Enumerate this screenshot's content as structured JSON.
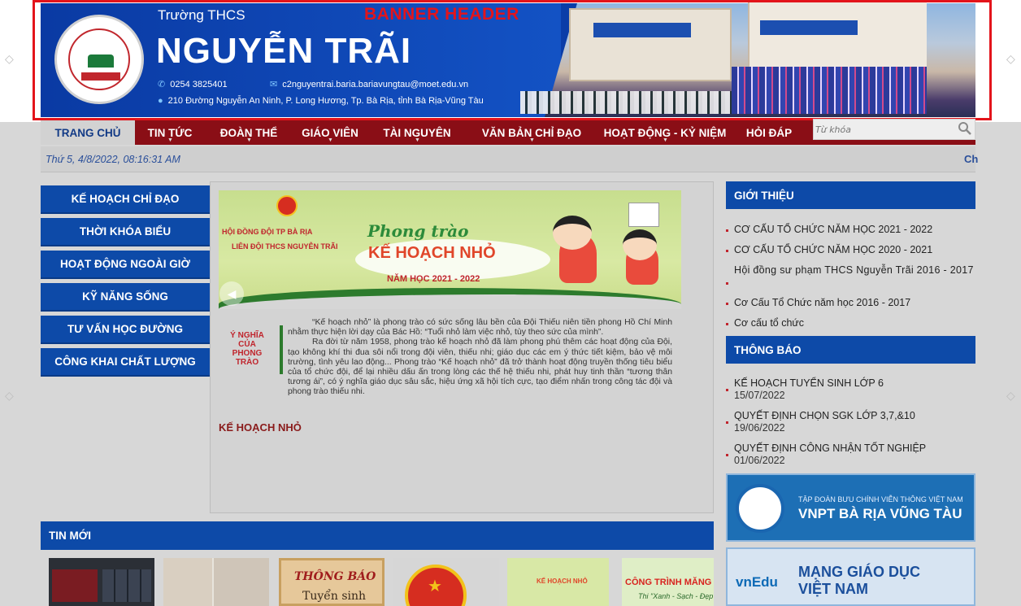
{
  "banner": {
    "tag": "BANNER HEADER",
    "school_prefix": "Trường THCS",
    "school_name": "NGUYỄN TRÃI",
    "phone": "0254 3825401",
    "email": "c2nguyentrai.baria.bariavungtau@moet.edu.vn",
    "address": "210 Đường Nguyễn An Ninh, P. Long Hương, Tp. Bà Rịa, tỉnh Bà Rịa-Vũng Tàu",
    "logo_text": "NGUYỄN TRÃI",
    "icons": [
      "phone-icon",
      "email-icon",
      "location-icon"
    ]
  },
  "nav": {
    "items": [
      {
        "label": "TRANG CHỦ",
        "active": true
      },
      {
        "label": "TIN TỨC"
      },
      {
        "label": "ĐOÀN THỂ"
      },
      {
        "label": "GIÁO VIÊN"
      },
      {
        "label": "TÀI NGUYÊN"
      },
      {
        "label": "VĂN BẢN CHỈ ĐẠO"
      },
      {
        "label": "HOẠT ĐỘNG - KỶ NIỆM"
      },
      {
        "label": "HỎI ĐÁP"
      }
    ],
    "search_placeholder": "Từ khóa"
  },
  "datebar": {
    "date": "Thứ 5, 4/8/2022, 08:16:31 AM",
    "marquee": "Ch"
  },
  "left_menu": [
    "KẾ HOẠCH CHỈ ĐẠO",
    "THỜI KHÓA BIỂU",
    "HOẠT ĐỘNG NGOÀI GIỜ",
    "KỸ NĂNG SỐNG",
    "TƯ VẤN HỌC ĐƯỜNG",
    "CÔNG KHAI CHẤT LƯỢNG"
  ],
  "poster": {
    "org_line1": "HỘI ĐỒNG ĐỘI TP BÀ RỊA",
    "org_line2": "LIÊN ĐỘI THCS NGUYỄN TRÃI",
    "movement": "Phong trào",
    "title": "KẾ HOẠCH NHỎ",
    "year": "NĂM HỌC 2021 - 2022",
    "meaning_label": "Ý NGHĨA CỦA PHONG TRÀO",
    "paragraph1": "“Kế hoạch nhỏ” là phong trào có sức sống lâu bền của Đội Thiếu niên tiền phong Hồ Chí Minh nhằm thực hiện lời dạy của Bác Hồ: “Tuổi nhỏ làm việc nhỏ, tùy theo sức của mình”.",
    "paragraph2": "Ra đời từ năm 1958, phong trào kế hoạch nhỏ đã làm phong phú thêm các hoạt động của Đội, tạo không khí thi đua sôi nổi trong đội viên, thiếu nhi; giáo dục các em ý thức tiết kiệm, bảo vệ môi trường, tình yêu lao động... Phong trào “Kế hoạch nhỏ” đã trở thành hoạt động truyền thống tiêu biểu của tổ chức đội, để lại nhiều dấu ấn trong lòng các thế hệ thiếu nhi, phát huy tinh thần “tương thân tương ái”, có ý nghĩa giáo dục sâu sắc, hiệu ứng xã hội tích cực, tạo điểm nhấn trong công tác đội và phong trào thiếu nhi.",
    "caption": "KẾ HOẠCH NHỎ"
  },
  "gioi_thieu": {
    "title": "GIỚI THIỆU",
    "items": [
      "CƠ CẤU TỔ CHỨC NĂM HỌC 2021 - 2022",
      "CƠ CẤU TỔ CHỨC NĂM HỌC 2020 - 2021",
      "Hội đồng sư phạm THCS Nguyễn Trãi 2016 - 2017",
      "Cơ Cấu Tổ Chức năm học 2016 - 2017",
      "Cơ cấu tổ chức"
    ]
  },
  "thong_bao": {
    "title": "THÔNG BÁO",
    "items": [
      {
        "title": "KẾ HOẠCH TUYỂN SINH LỚP 6",
        "date": "15/07/2022"
      },
      {
        "title": "QUYẾT ĐỊNH CHỌN SGK LỚP 3,7,&10",
        "date": "19/06/2022"
      },
      {
        "title": "QUYẾT ĐỊNH CÔNG NHẬN TỐT NGHIỆP",
        "date": "01/06/2022"
      }
    ]
  },
  "ads": {
    "vnpt_small": "TẬP ĐOÀN BƯU CHÍNH VIỄN THÔNG VIỆT NAM",
    "vnpt_big": "VNPT BÀ RỊA VŨNG TÀU",
    "vnedu_logo": "vnEdu",
    "vnedu_line1": "MẠNG GIÁO DỤC",
    "vnedu_line2": "VIỆT NAM"
  },
  "tin_moi": {
    "title": "TIN MỚI",
    "thumb3_line1": "THÔNG BÁO",
    "thumb3_line2": "Tuyển sinh",
    "thumb6_text": "CÔNG TRÌNH MĂNG NO",
    "thumb6_sub": "Thi \"Xanh - Sạch - Đẹp\"",
    "thumb5_text": "KẾ HOẠCH NHỎ"
  },
  "colors": {
    "nav_bg": "#8a0e16",
    "header_blue": "#0d4aa8",
    "banner_red_outline": "#e3141b"
  }
}
